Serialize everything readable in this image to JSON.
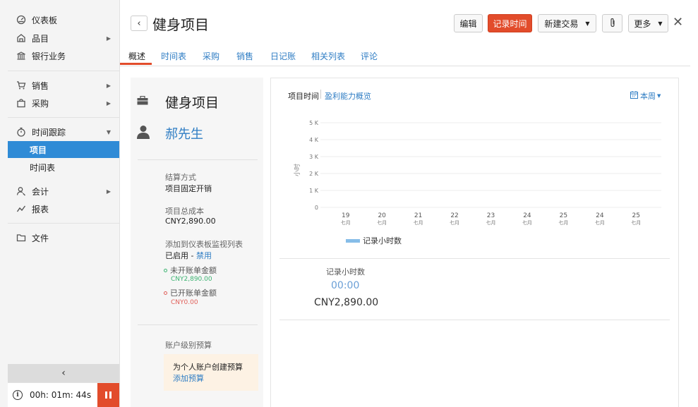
{
  "sidebar": {
    "items": [
      {
        "label": "仪表板",
        "icon": "dashboard-icon",
        "has_arrow": false
      },
      {
        "label": "品目",
        "icon": "items-icon",
        "has_arrow": true
      },
      {
        "label": "银行业务",
        "icon": "bank-icon",
        "has_arrow": false
      },
      {
        "label": "销售",
        "icon": "cart-icon",
        "has_arrow": true
      },
      {
        "label": "采购",
        "icon": "bag-icon",
        "has_arrow": true
      },
      {
        "label": "时间跟踪",
        "icon": "stopwatch-icon",
        "has_arrow": true
      },
      {
        "label": "项目",
        "active": true
      },
      {
        "label": "时间表"
      },
      {
        "label": "会计",
        "icon": "accountant-icon",
        "has_arrow": true
      },
      {
        "label": "报表",
        "icon": "reports-icon",
        "has_arrow": false
      },
      {
        "label": "文件",
        "icon": "folder-icon",
        "has_arrow": false
      }
    ],
    "collapse_glyph": "‹",
    "timer": {
      "value": "00h: 01m: 44s"
    }
  },
  "header": {
    "back_glyph": "‹",
    "title": "健身项目",
    "edit_label": "编辑",
    "log_time_label": "记录时间",
    "new_transaction_label": "新建交易",
    "more_label": "更多",
    "close_glyph": "✕"
  },
  "tabs": [
    "概述",
    "时间表",
    "采购",
    "销售",
    "日记账",
    "相关列表",
    "评论"
  ],
  "active_tab": "概述",
  "info": {
    "project_name": "健身项目",
    "customer_name": "郝先生",
    "billing_method_label": "结算方式",
    "billing_method_value": "项目固定开销",
    "total_cost_label": "项目总成本",
    "total_cost_value": "CNY2,890.00",
    "watchlist_label": "添加到仪表板监视列表",
    "watchlist_status": "已启用",
    "watchlist_separator": " - ",
    "watchlist_action": "禁用",
    "unbilled_label": "未开账单金额",
    "unbilled_value": "CNY2,890.00",
    "billed_label": "已开账单金额",
    "billed_value": "CNY0.00",
    "budget_label": "账户级别预算",
    "budget_prompt": "为个人账户创建预算",
    "budget_link": "添加预算",
    "colors": {
      "unbilled": "#3cb371",
      "billed": "#e0605a",
      "link": "#2f7dc4"
    }
  },
  "chart_panel": {
    "tab_project_hours": "项目时间",
    "tab_profitability": "盈利能力概览",
    "period_label": "本周",
    "summary_label": "记录小时数",
    "summary_time": "00:00",
    "summary_amount": "CNY2,890.00"
  },
  "chart_data": {
    "type": "bar",
    "ylabel": "小时",
    "ylim": [
      0,
      5000
    ],
    "y_ticks": [
      "0",
      "1 K",
      "2 K",
      "3 K",
      "4 K",
      "5 K"
    ],
    "categories": [
      {
        "day": "19",
        "month": "七月"
      },
      {
        "day": "20",
        "month": "七月"
      },
      {
        "day": "21",
        "month": "七月"
      },
      {
        "day": "22",
        "month": "七月"
      },
      {
        "day": "23",
        "month": "七月"
      },
      {
        "day": "24",
        "month": "七月"
      },
      {
        "day": "25",
        "month": "七月"
      },
      {
        "day": "24",
        "month": "七月"
      },
      {
        "day": "25",
        "month": "七月"
      }
    ],
    "series": [
      {
        "name": "记录小时数",
        "values": [
          0,
          0,
          0,
          0,
          0,
          0,
          0,
          0,
          0
        ],
        "color": "#86bde8"
      }
    ],
    "grid": true,
    "legend_position": "bottom-left"
  }
}
